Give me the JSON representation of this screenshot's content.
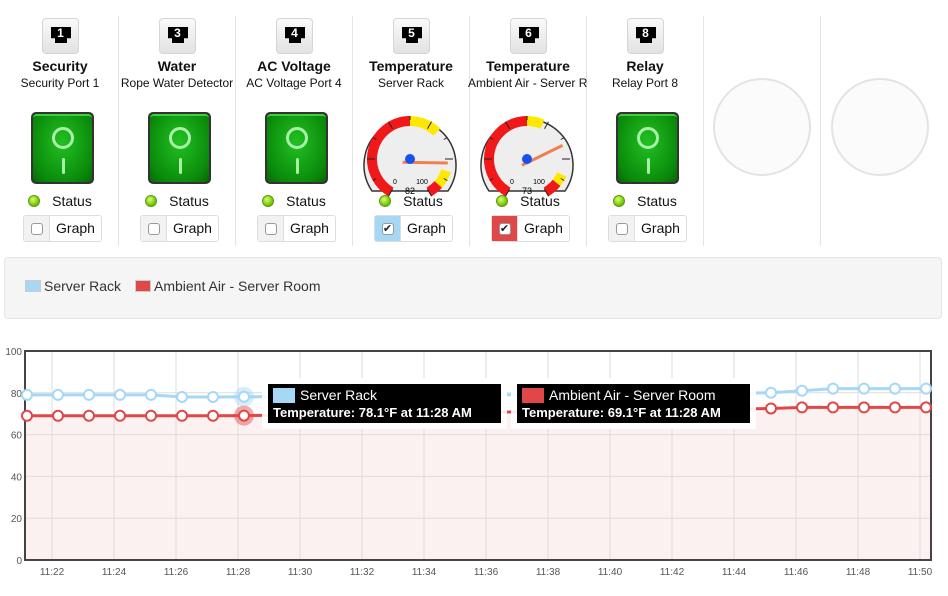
{
  "devices": [
    {
      "port": "1",
      "title": "Security",
      "subtitle": "Security Port 1",
      "type": "switch",
      "status": "Status",
      "graph": "Graph",
      "checked": false
    },
    {
      "port": "3",
      "title": "Water",
      "subtitle": "Rope Water Detector",
      "type": "switch",
      "status": "Status",
      "graph": "Graph",
      "checked": false
    },
    {
      "port": "4",
      "title": "AC Voltage",
      "subtitle": "AC Voltage Port 4",
      "type": "switch",
      "status": "Status",
      "graph": "Graph",
      "checked": false
    },
    {
      "port": "5",
      "title": "Temperature",
      "subtitle": "Server Rack",
      "type": "gauge",
      "value": 82,
      "min_label": "0",
      "max_label": "100",
      "bands": [
        [
          "red",
          0,
          50
        ],
        [
          "yellow",
          50,
          65
        ],
        [
          "yellow",
          86,
          94
        ],
        [
          "red",
          94,
          100
        ]
      ],
      "status": "Status",
      "graph": "Graph",
      "checked": true,
      "check_color": "#a6d8f5"
    },
    {
      "port": "6",
      "title": "Temperature",
      "subtitle": "Ambient Air - Server Room",
      "type": "gauge",
      "value": 73,
      "min_label": "0",
      "max_label": "100",
      "bands": [
        [
          "red",
          0,
          50
        ],
        [
          "yellow",
          50,
          58
        ],
        [
          "yellow",
          88,
          93
        ],
        [
          "red",
          93,
          100
        ]
      ],
      "status": "Status",
      "graph": "Graph",
      "checked": true,
      "check_color": "#e04848"
    },
    {
      "port": "8",
      "title": "Relay",
      "subtitle": "Relay Port 8",
      "type": "switch",
      "status": "Status",
      "graph": "Graph",
      "checked": false
    }
  ],
  "legend": [
    {
      "name": "Server Rack",
      "color": "#a6d8f5"
    },
    {
      "name": "Ambient Air - Server Room",
      "color": "#e04848"
    }
  ],
  "tooltips": [
    {
      "series": "Server Rack",
      "color": "#a6d8f5",
      "text": "Temperature: 78.1°F at 11:28 AM"
    },
    {
      "series": "Ambient Air - Server Room",
      "color": "#e04848",
      "text": "Temperature: 69.1°F at 11:28 AM"
    }
  ],
  "chart_data": {
    "type": "line",
    "ylim": [
      0,
      100
    ],
    "yticks": [
      "0",
      "20",
      "40",
      "60",
      "80",
      "100"
    ],
    "xticks": [
      "11:22",
      "11:24",
      "11:26",
      "11:28",
      "11:30",
      "11:32",
      "11:34",
      "11:36",
      "11:38",
      "11:40",
      "11:42",
      "11:44",
      "11:46",
      "11:48",
      "11:50"
    ],
    "grid": true,
    "series": [
      {
        "name": "Server Rack",
        "color": "#a6d8f5",
        "x": [
          "11:21",
          "11:22",
          "11:23",
          "11:24",
          "11:25",
          "11:26",
          "11:27",
          "11:28",
          "11:45",
          "11:46",
          "11:47",
          "11:48",
          "11:49",
          "11:50"
        ],
        "values": [
          79,
          79,
          79,
          79,
          79,
          78,
          78,
          78.1,
          80,
          81,
          82,
          82,
          82,
          82
        ]
      },
      {
        "name": "Ambient Air - Server Room",
        "color": "#e04848",
        "x": [
          "11:21",
          "11:22",
          "11:23",
          "11:24",
          "11:25",
          "11:26",
          "11:27",
          "11:28",
          "11:45",
          "11:46",
          "11:47",
          "11:48",
          "11:49",
          "11:50"
        ],
        "values": [
          69,
          69,
          69,
          69,
          69,
          69,
          69,
          69.1,
          72.5,
          73,
          73,
          73,
          73,
          73
        ]
      }
    ]
  }
}
